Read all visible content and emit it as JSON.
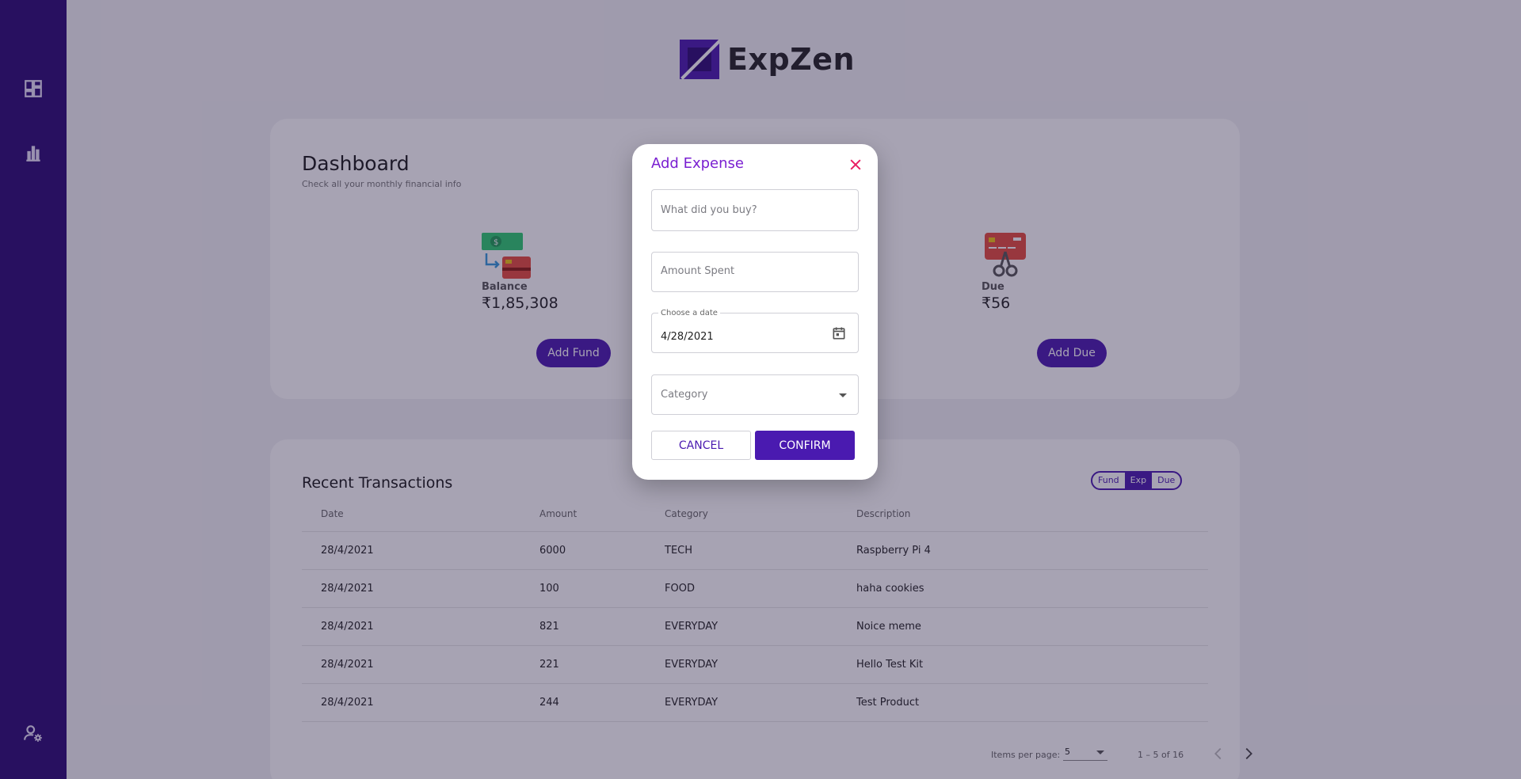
{
  "app": {
    "name": "ExpZen"
  },
  "sidebar": {
    "icons": [
      "dashboard-icon",
      "bar-chart-icon",
      "user-settings-icon"
    ]
  },
  "dashboard": {
    "title": "Dashboard",
    "subtitle": "Check all your monthly financial info",
    "balance": {
      "label": "Balance",
      "value": "₹1,85,308",
      "button": "Add Fund"
    },
    "due": {
      "label": "Due",
      "value": "₹56",
      "button": "Add Due"
    }
  },
  "transactions": {
    "title": "Recent Transactions",
    "toggle": [
      "Fund",
      "Exp",
      "Due"
    ],
    "toggle_active": "Exp",
    "columns": [
      "Date",
      "Amount",
      "Category",
      "Description"
    ],
    "rows": [
      {
        "date": "28/4/2021",
        "amount": "6000",
        "category": "TECH",
        "description": "Raspberry Pi 4"
      },
      {
        "date": "28/4/2021",
        "amount": "100",
        "category": "FOOD",
        "description": "haha cookies"
      },
      {
        "date": "28/4/2021",
        "amount": "821",
        "category": "EVERYDAY",
        "description": "Noice meme"
      },
      {
        "date": "28/4/2021",
        "amount": "221",
        "category": "EVERYDAY",
        "description": "Hello Test Kit"
      },
      {
        "date": "28/4/2021",
        "amount": "244",
        "category": "EVERYDAY",
        "description": "Test Product"
      }
    ],
    "paginator": {
      "label": "Items per page:",
      "per_page": "5",
      "range": "1 – 5 of 16"
    }
  },
  "dialog": {
    "title": "Add Expense",
    "item_placeholder": "What did you buy?",
    "amount_placeholder": "Amount Spent",
    "date_label": "Choose a date",
    "date_value": "4/28/2021",
    "category_placeholder": "Category",
    "cancel": "CANCEL",
    "confirm": "CONFIRM"
  },
  "colors": {
    "primary": "#4a1ab0",
    "sidebar": "#2c0a75",
    "dialog_title": "#7a1fd1",
    "close": "#e91e63"
  }
}
